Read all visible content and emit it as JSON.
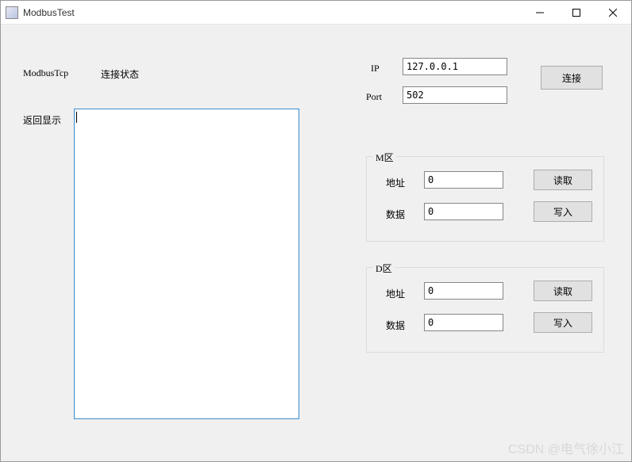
{
  "window": {
    "title": "ModbusTest"
  },
  "left": {
    "protocol_label": "ModbusTcp",
    "status_label": "连接状态",
    "return_label": "返回显示",
    "return_value": ""
  },
  "conn": {
    "ip_label": "IP",
    "ip_value": "127.0.0.1",
    "port_label": "Port",
    "port_value": "502",
    "connect_btn": "连接"
  },
  "m_zone": {
    "title": "M区",
    "addr_label": "地址",
    "addr_value": "0",
    "data_label": "数据",
    "data_value": "0",
    "read_btn": "读取",
    "write_btn": "写入"
  },
  "d_zone": {
    "title": "D区",
    "addr_label": "地址",
    "addr_value": "0",
    "data_label": "数据",
    "data_value": "0",
    "read_btn": "读取",
    "write_btn": "写入"
  },
  "watermark": "CSDN @电气徐小江"
}
